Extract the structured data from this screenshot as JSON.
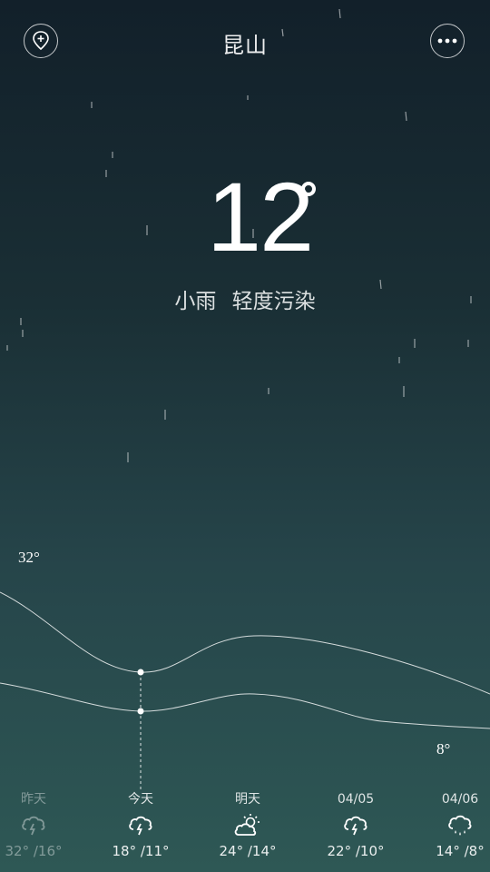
{
  "header": {
    "city": "昆山",
    "add_icon": "location-add-icon",
    "more_icon": "more-icon"
  },
  "current": {
    "temperature": "12",
    "degree_symbol": "°",
    "condition": "小雨",
    "air_quality": "轻度污染"
  },
  "trend": {
    "max_label": "32°",
    "min_label": "8°"
  },
  "forecast": [
    {
      "day": "昨天",
      "high": "32°",
      "low": "/16°",
      "icon": "thunder-rain-icon",
      "dim": true
    },
    {
      "day": "今天",
      "high": "18°",
      "low": "/11°",
      "icon": "thunder-rain-icon",
      "dim": false
    },
    {
      "day": "明天",
      "high": "24°",
      "low": "/14°",
      "icon": "partly-cloudy-icon",
      "dim": false
    },
    {
      "day": "04/05",
      "high": "22°",
      "low": "/10°",
      "icon": "thunder-rain-icon",
      "dim": false
    },
    {
      "day": "04/06",
      "high": "14°",
      "low": "/8°",
      "icon": "rain-icon",
      "dim": false
    }
  ]
}
